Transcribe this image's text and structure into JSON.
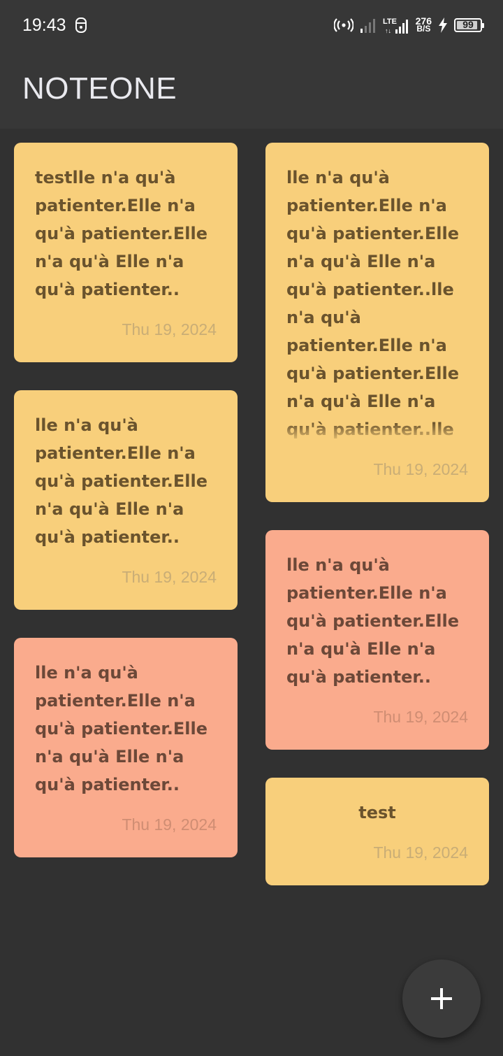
{
  "status_bar": {
    "time": "19:43",
    "network_type": "LTE",
    "net_speed_value": "276",
    "net_speed_unit": "B/S",
    "battery": "99",
    "icons": [
      "notification-icon",
      "hotspot-icon",
      "signal-icon",
      "lte-signal-icon",
      "charging-icon",
      "battery-icon"
    ]
  },
  "app_bar": {
    "title": "NOTEONE"
  },
  "notes": [
    {
      "text": "testlle n'a qu'à patienter.Elle n'a qu'à patienter.Elle n'a qu'à Elle n'a qu'à patienter..",
      "date": "Thu 19, 2024",
      "color": "#f8cf7b"
    },
    {
      "text": "lle n'a qu'à patienter.Elle n'a qu'à patienter.Elle n'a qu'à Elle n'a qu'à patienter..lle n'a qu'à patienter.Elle n'a qu'à patienter.Elle n'a qu'à Elle n'a qu'à patienter..lle n'a",
      "date": "Thu 19, 2024",
      "color": "#f8cf7b"
    },
    {
      "text": "lle n'a qu'à patienter.Elle n'a qu'à patienter.Elle n'a qu'à Elle n'a qu'à patienter..",
      "date": "Thu 19, 2024",
      "color": "#f8cf7b"
    },
    {
      "text": "lle n'a qu'à patienter.Elle n'a qu'à patienter.Elle n'a qu'à Elle n'a qu'à patienter..",
      "date": "Thu 19, 2024",
      "color": "#faab8d"
    },
    {
      "text": "lle n'a qu'à patienter.Elle n'a qu'à patienter.Elle n'a qu'à Elle n'a qu'à patienter..",
      "date": "Thu 19, 2024",
      "color": "#faab8d"
    },
    {
      "text": "test",
      "date": "Thu 19, 2024",
      "color": "#f8cf7b"
    }
  ],
  "fab": {
    "icon": "plus-icon"
  }
}
